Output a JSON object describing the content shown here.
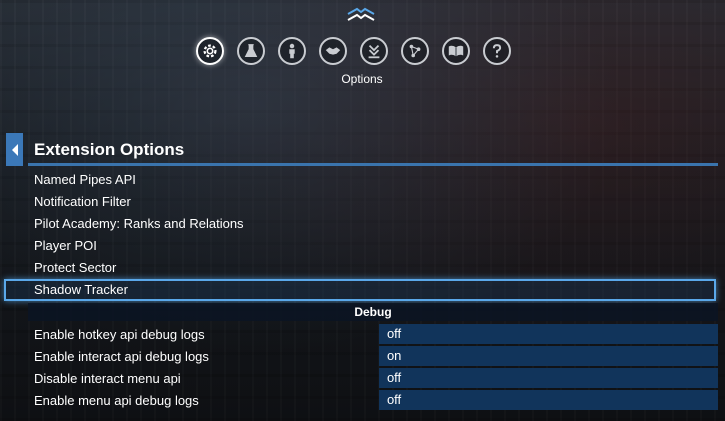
{
  "nav": {
    "active_label": "Options",
    "icons": [
      "gear-icon",
      "flask-icon",
      "person-icon",
      "handshake-icon",
      "download-icon",
      "network-icon",
      "book-icon",
      "help-icon"
    ]
  },
  "panel": {
    "title": "Extension Options"
  },
  "extensions": [
    "Named Pipes API",
    "Notification Filter",
    "Pilot Academy: Ranks and Relations",
    "Player POI",
    "Protect Sector",
    "Shadow Tracker"
  ],
  "selected_extension_index": 5,
  "debug": {
    "header": "Debug",
    "rows": [
      {
        "label": "Enable hotkey api debug logs",
        "value": "off"
      },
      {
        "label": "Enable interact api debug logs",
        "value": "on"
      },
      {
        "label": "Disable interact menu api",
        "value": "off"
      },
      {
        "label": "Enable menu api debug logs",
        "value": "off"
      }
    ]
  },
  "colors": {
    "accent": "#3a74ad",
    "selection": "#5aa8ea",
    "value_bg": "#11345b"
  }
}
